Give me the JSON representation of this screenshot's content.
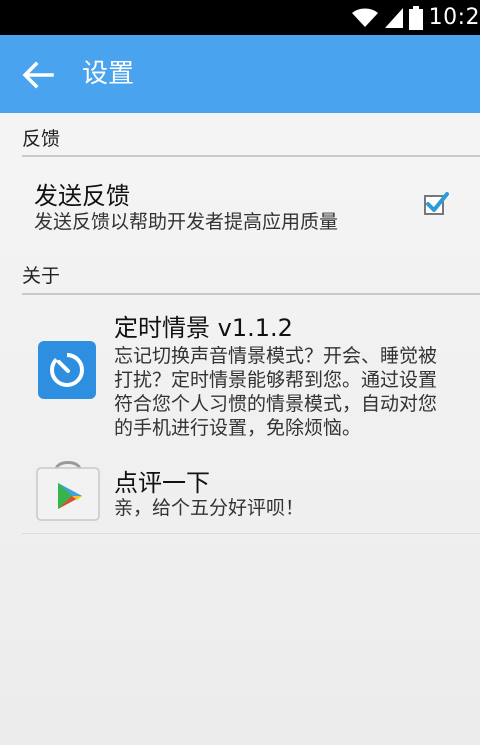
{
  "status_bar": {
    "time": "10:2"
  },
  "app_bar": {
    "title": "设置"
  },
  "sections": {
    "feedback": {
      "header": "反馈",
      "item": {
        "title": "发送反馈",
        "summary": "发送反馈以帮助开发者提高应用质量",
        "checked": true
      }
    },
    "about": {
      "header": "关于",
      "app_item": {
        "title": "定时情景 v1.1.2",
        "summary_lines": [
          "忘记切换声音情景模式？开会、睡觉被",
          "打扰？定时情景能够帮到您。通过设置",
          "符合您个人习惯的情景模式，自动对您",
          "的手机进行设置，免除烦恼。"
        ]
      },
      "rate_item": {
        "title": "点评一下",
        "summary": "亲，给个五分好评呗！"
      }
    }
  },
  "colors": {
    "app_bar": "#4aa3ef",
    "timer_icon_bg": "#2e8fe0",
    "checkbox_check": "#2f9ad8"
  }
}
